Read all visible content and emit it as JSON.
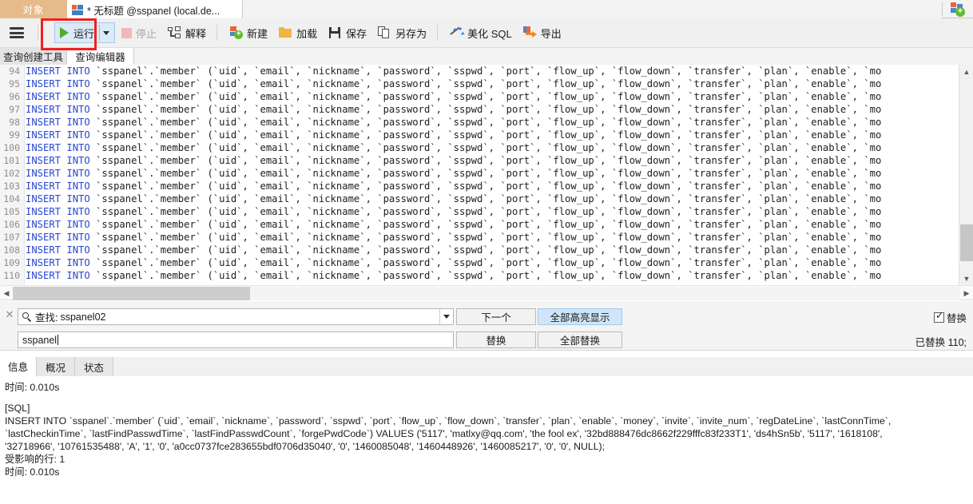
{
  "window": {
    "tabs": [
      {
        "label": "对象",
        "kind": "object-pane"
      },
      {
        "label": "* 无标题 @sspanel (local.de...",
        "kind": "query-editor"
      }
    ],
    "new_connection_icon": "new-connection-icon"
  },
  "toolbar": {
    "menu_icon": "hamburger-menu-icon",
    "run_label": "运行",
    "run_dropdown_icon": "chevron-down-icon",
    "stop_label": "停止",
    "explain_label": "解释",
    "new_label": "新建",
    "load_label": "加载",
    "save_label": "保存",
    "save_as_label": "另存为",
    "beautify_label": "美化 SQL",
    "export_label": "导出"
  },
  "inner_tabs": [
    {
      "label": "查询创建工具",
      "active": false
    },
    {
      "label": "查询编辑器",
      "active": true
    }
  ],
  "editor": {
    "first_line_number": 94,
    "line_numbers": [
      94,
      95,
      96,
      97,
      98,
      99,
      100,
      101,
      102,
      103,
      104,
      105,
      106,
      107,
      108,
      109,
      110
    ],
    "line_keyword": "INSERT INTO",
    "line_rest": " `sspanel`.`member` (`uid`, `email`, `nickname`, `password`, `sspwd`, `port`, `flow_up`, `flow_down`, `transfer`, `plan`, `enable`, `mo",
    "vertical_scrollbar": "vertical-scrollbar",
    "horizontal_scrollbar": "horizontal-scrollbar"
  },
  "find_replace": {
    "close_icon": "close-icon",
    "search_icon": "search-icon",
    "find_label": "查找:",
    "find_value": "sspanel02",
    "find_dropdown_icon": "chevron-down-icon",
    "replace_value": "sspanel",
    "next_button": "下一个",
    "highlight_all_button": "全部高亮显示",
    "replace_button": "替换",
    "replace_all_button": "全部替换",
    "replace_checkbox_label": "替换",
    "replace_checkbox_checked": true,
    "status": "已替换 110;"
  },
  "result_tabs": [
    {
      "label": "信息",
      "active": true
    },
    {
      "label": "概况",
      "active": false
    },
    {
      "label": "状态",
      "active": false
    }
  ],
  "log": {
    "time_top": "时间: 0.010s",
    "sql_tag": "[SQL]",
    "sql_line1": "INSERT INTO `sspanel`.`member` (`uid`, `email`, `nickname`, `password`, `sspwd`, `port`, `flow_up`, `flow_down`, `transfer`, `plan`, `enable`, `money`, `invite`, `invite_num`, `regDateLine`, `lastConnTime`,",
    "sql_line2": "`lastCheckinTime`, `lastFindPasswdTime`, `lastFindPasswdCount`, `forgePwdCode`) VALUES ('5117', 'matlxy@qq.com', 'the fool ex', '32bd888476dc8662f229fffc83f233T1', 'ds4hSn5b', '5117', '1618108',",
    "sql_line3": "'32718966', '10761535488', 'A', '1', '0', 'a0cc0737fce283655bdf0706d35040', '0', '1460085048', '1460448926', '1460085217', '0', '0', NULL);",
    "affected_rows": "受影响的行: 1",
    "time_bottom": "时间: 0.010s"
  },
  "annotations": {
    "run_highlight_color": "#f02020"
  }
}
